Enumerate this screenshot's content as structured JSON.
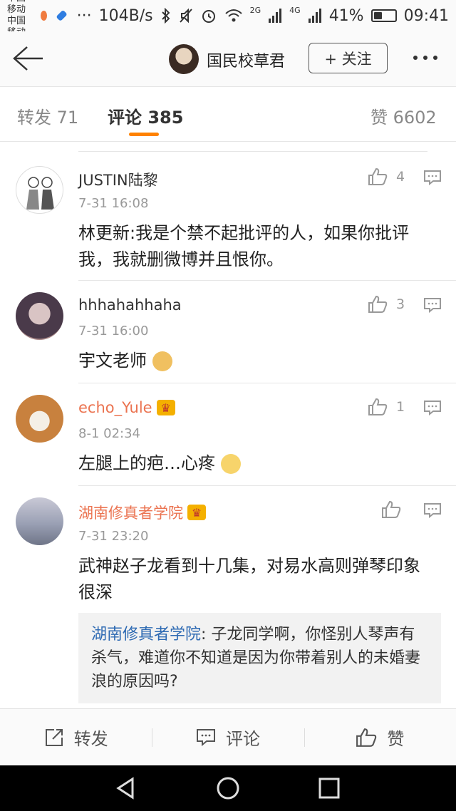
{
  "status_bar": {
    "carrier_1": "中国移动",
    "carrier_2": "中国移动",
    "dots": "···",
    "network_speed": "104B/s",
    "net_2g": "2G",
    "net_4g": "4G",
    "battery_percent": "41%",
    "battery_level": 0.41,
    "time": "09:41",
    "icons": [
      "bluetooth-icon",
      "mute-icon",
      "alarm-icon",
      "wifi-icon",
      "signal-icon",
      "battery-icon"
    ]
  },
  "header": {
    "title": "国民校草君",
    "follow_label": "+ 关注",
    "icons": [
      "back-arrow-icon",
      "more-icon"
    ]
  },
  "tabs": [
    {
      "label": "转发 71",
      "active": false
    },
    {
      "label": "评论 385",
      "active": true
    },
    {
      "label": "赞 6602",
      "active": false
    }
  ],
  "accent_color": "#ff8200",
  "comments": [
    {
      "user": "JUSTIN陆黎",
      "time": "7-31 16:08",
      "likes": "4",
      "text": "林更新:我是个禁不起批评的人，如果你批评我，我就删微博并且恨你。",
      "vip": false
    },
    {
      "user": "hhhahahhaha",
      "time": "7-31 16:00",
      "likes": "3",
      "text": "宇文老师",
      "vip": false
    },
    {
      "user": "echo_Yule",
      "time": "8-1 02:34",
      "likes": "1",
      "text": "左腿上的疤…心疼",
      "vip": true
    },
    {
      "user": "湖南修真者学院",
      "time": "7-31 23:20",
      "likes": "",
      "text": "武神赵子龙看到十几集，对易水高则弹琴印象很深",
      "vip": true
    }
  ],
  "sub_reply": {
    "user": "湖南修真者学院",
    "text": ": 子龙同学啊，你怪别人琴声有杀气，难道你不知道是因为你带着别人的未婚妻浪的原因吗?"
  },
  "bottom_bar": {
    "repost": "转发",
    "comment": "评论",
    "like": "赞"
  },
  "nav_bar": {
    "icons": [
      "back-triangle-icon",
      "home-circle-icon",
      "recents-square-icon"
    ]
  }
}
